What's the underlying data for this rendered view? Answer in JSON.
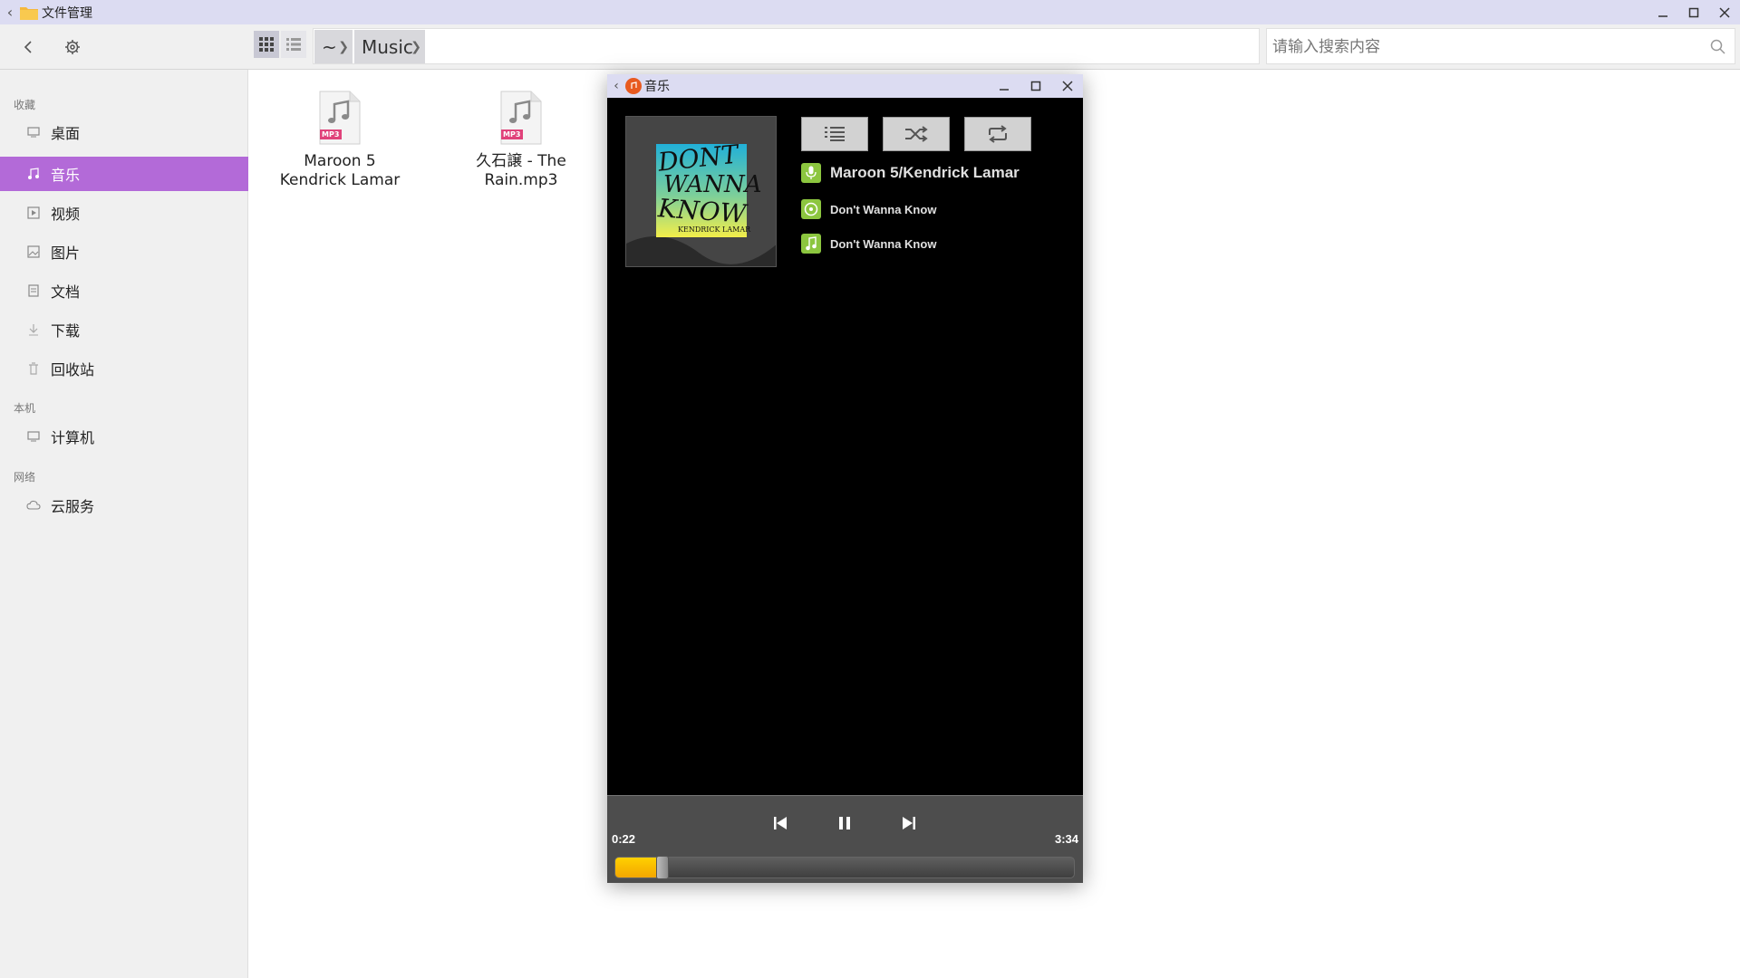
{
  "file_manager": {
    "title": "文件管理",
    "search": {
      "placeholder": "请输入搜索内容"
    },
    "breadcrumb": [
      "~",
      "Music"
    ],
    "sidebar": {
      "sections": [
        {
          "heading": "收藏"
        },
        {
          "heading": "本机"
        },
        {
          "heading": "网络"
        }
      ],
      "items": [
        {
          "label": "桌面",
          "icon": "desktop-icon"
        },
        {
          "label": "音乐",
          "icon": "music-icon",
          "active": true
        },
        {
          "label": "视频",
          "icon": "video-icon"
        },
        {
          "label": "图片",
          "icon": "image-icon"
        },
        {
          "label": "文档",
          "icon": "document-icon"
        },
        {
          "label": "下载",
          "icon": "download-icon"
        },
        {
          "label": "回收站",
          "icon": "trash-icon"
        },
        {
          "label": "计算机",
          "icon": "computer-icon"
        },
        {
          "label": "云服务",
          "icon": "cloud-icon"
        }
      ]
    },
    "files": [
      {
        "name_line1": "Maroon 5",
        "name_line2": "Kendrick Lamar",
        "badge": "MP3"
      },
      {
        "name_line1": "久石譲 - The",
        "name_line2": "Rain.mp3",
        "badge": "MP3"
      }
    ]
  },
  "music_player": {
    "title": "音乐",
    "album_art_text": {
      "line1": "DONT",
      "line2": "WANNA",
      "line3": "KNOW",
      "line4": "KENDRICK LAMAR"
    },
    "artist": "Maroon 5/Kendrick Lamar",
    "album": "Don't Wanna Know",
    "track": "Don't Wanna Know",
    "current_time": "0:22",
    "total_time": "3:34",
    "progress_fraction": 0.103,
    "colors": {
      "accent": "#b36ad8",
      "progress": "#f5b400",
      "meta_icon": "#8cc63f"
    }
  }
}
